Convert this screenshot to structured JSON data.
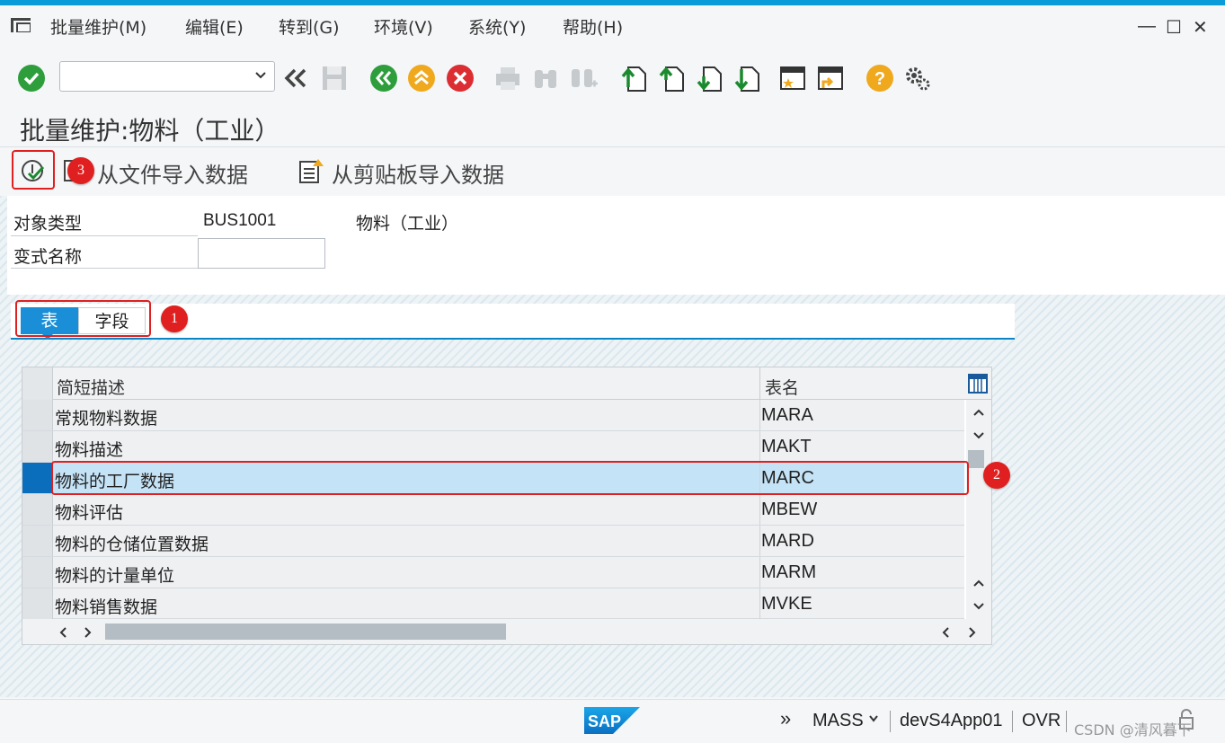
{
  "menu": {
    "items": [
      "批量维护(M)",
      "编辑(E)",
      "转到(G)",
      "环境(V)",
      "系统(Y)",
      "帮助(H)"
    ]
  },
  "window_controls": {
    "minimize": "—",
    "maximize": "☐",
    "close": "✕"
  },
  "toolbar": {
    "command_field_value": "",
    "icons": [
      "check-icon",
      "back-double-icon",
      "save-icon",
      "back-icon",
      "exit-icon",
      "cancel-icon",
      "print-icon",
      "find-icon",
      "find-next-icon",
      "first-page-icon",
      "previous-page-icon",
      "next-page-icon",
      "last-page-icon",
      "create-session-icon",
      "shortcut-icon",
      "help-icon",
      "settings-icon"
    ]
  },
  "title": "批量维护:物料（工业）",
  "app_toolbar": {
    "import_file_label": "从文件导入数据",
    "import_clipboard_label": "从剪贴板导入数据"
  },
  "annotations": {
    "badge1": "1",
    "badge2": "2",
    "badge3": "3"
  },
  "form": {
    "object_type_label": "对象类型",
    "object_type_value": "BUS1001",
    "object_type_desc": "物料（工业）",
    "variant_label": "变式名称",
    "variant_value": ""
  },
  "tabs": [
    {
      "label": "表",
      "active": true
    },
    {
      "label": "字段",
      "active": false
    }
  ],
  "table": {
    "columns": [
      "简短描述",
      "表名"
    ],
    "rows": [
      {
        "desc": "常规物料数据",
        "name": "MARA",
        "selected": false
      },
      {
        "desc": "物料描述",
        "name": "MAKT",
        "selected": false
      },
      {
        "desc": "物料的工厂数据",
        "name": "MARC",
        "selected": true
      },
      {
        "desc": "物料评估",
        "name": "MBEW",
        "selected": false
      },
      {
        "desc": "物料的仓储位置数据",
        "name": "MARD",
        "selected": false
      },
      {
        "desc": "物料的计量单位",
        "name": "MARM",
        "selected": false
      },
      {
        "desc": "物料销售数据",
        "name": "MVKE",
        "selected": false
      }
    ]
  },
  "status": {
    "expand": "»",
    "transaction": "MASS",
    "server": "devS4App01",
    "mode": "OVR",
    "logo": "SAP",
    "watermark": "CSDN @清风暮下"
  },
  "colors": {
    "accent": "#0a9bd9",
    "annotation_red": "#e02020",
    "selected_row": "#c5e3f6"
  }
}
